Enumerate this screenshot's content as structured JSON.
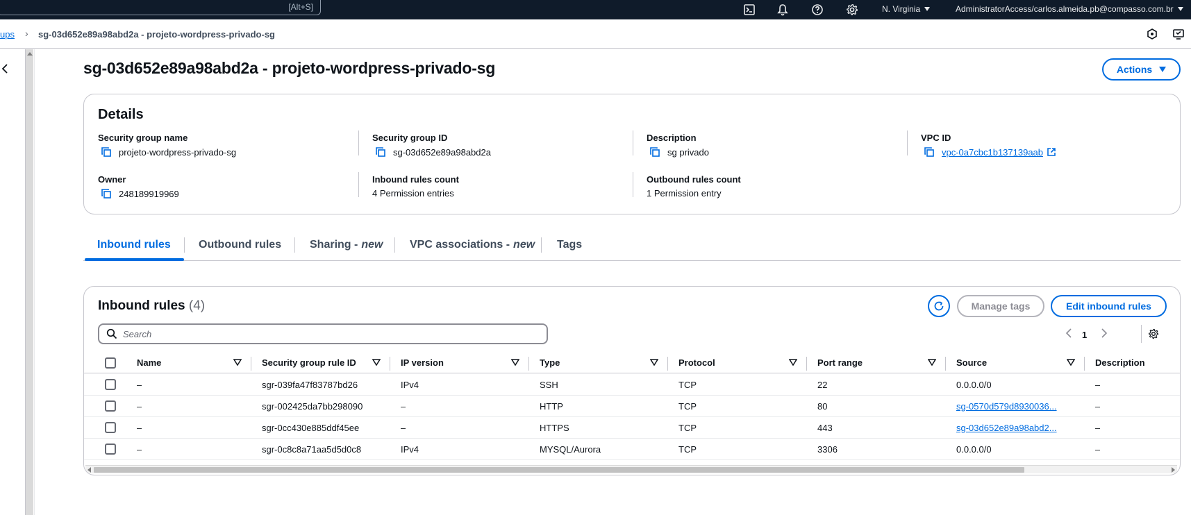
{
  "topbar": {
    "search_shortcut": "[Alt+S]",
    "icons": [
      "cloudshell-icon",
      "bell-icon",
      "help-icon",
      "gear-icon"
    ],
    "region": "N. Virginia",
    "account": "AdministratorAccess/carlos.almeida.pb@compasso.com.br"
  },
  "breadcrumb": {
    "parent": "ups",
    "current": "sg-03d652e89a98abd2a - projeto-wordpress-privado-sg"
  },
  "page": {
    "title": "sg-03d652e89a98abd2a - projeto-wordpress-privado-sg",
    "actions_label": "Actions"
  },
  "details": {
    "heading": "Details",
    "fields": {
      "sg_name": {
        "label": "Security group name",
        "value": "projeto-wordpress-privado-sg"
      },
      "sg_id": {
        "label": "Security group ID",
        "value": "sg-03d652e89a98abd2a"
      },
      "description": {
        "label": "Description",
        "value": "sg privado"
      },
      "vpc_id": {
        "label": "VPC ID",
        "value": "vpc-0a7cbc1b137139aab"
      },
      "owner": {
        "label": "Owner",
        "value": "248189919969"
      },
      "inbound_count": {
        "label": "Inbound rules count",
        "value": "4 Permission entries"
      },
      "outbound_count": {
        "label": "Outbound rules count",
        "value": "1 Permission entry"
      }
    }
  },
  "tabs": {
    "inbound": "Inbound rules",
    "outbound": "Outbound rules",
    "sharing": "Sharing -",
    "vpc_assoc": "VPC associations -",
    "new_tag": "new",
    "tags": "Tags"
  },
  "rules": {
    "heading": "Inbound rules",
    "count": "(4)",
    "manage_tags": "Manage tags",
    "edit_rules": "Edit inbound rules",
    "search_placeholder": "Search",
    "page_number": "1",
    "columns": [
      "Name",
      "Security group rule ID",
      "IP version",
      "Type",
      "Protocol",
      "Port range",
      "Source",
      "Description"
    ],
    "rows": [
      {
        "name": "–",
        "rule_id": "sgr-039fa47f83787bd26",
        "ip_version": "IPv4",
        "type": "SSH",
        "protocol": "TCP",
        "port": "22",
        "source": "0.0.0.0/0",
        "source_link": false,
        "description": "–"
      },
      {
        "name": "–",
        "rule_id": "sgr-002425da7bb298090",
        "ip_version": "–",
        "type": "HTTP",
        "protocol": "TCP",
        "port": "80",
        "source": "sg-0570d579d8930036...",
        "source_link": true,
        "description": "–"
      },
      {
        "name": "–",
        "rule_id": "sgr-0cc430e885ddf45ee",
        "ip_version": "–",
        "type": "HTTPS",
        "protocol": "TCP",
        "port": "443",
        "source": "sg-03d652e89a98abd2...",
        "source_link": true,
        "description": "–"
      },
      {
        "name": "–",
        "rule_id": "sgr-0c8c8a71aa5d5d0c8",
        "ip_version": "IPv4",
        "type": "MYSQL/Aurora",
        "protocol": "TCP",
        "port": "3306",
        "source": "0.0.0.0/0",
        "source_link": false,
        "description": "–"
      }
    ]
  },
  "colors": {
    "accent": "#006ce0",
    "topbar_bg": "#0f1b2a",
    "text": "#0f141a",
    "border": "#c6c6cd"
  }
}
